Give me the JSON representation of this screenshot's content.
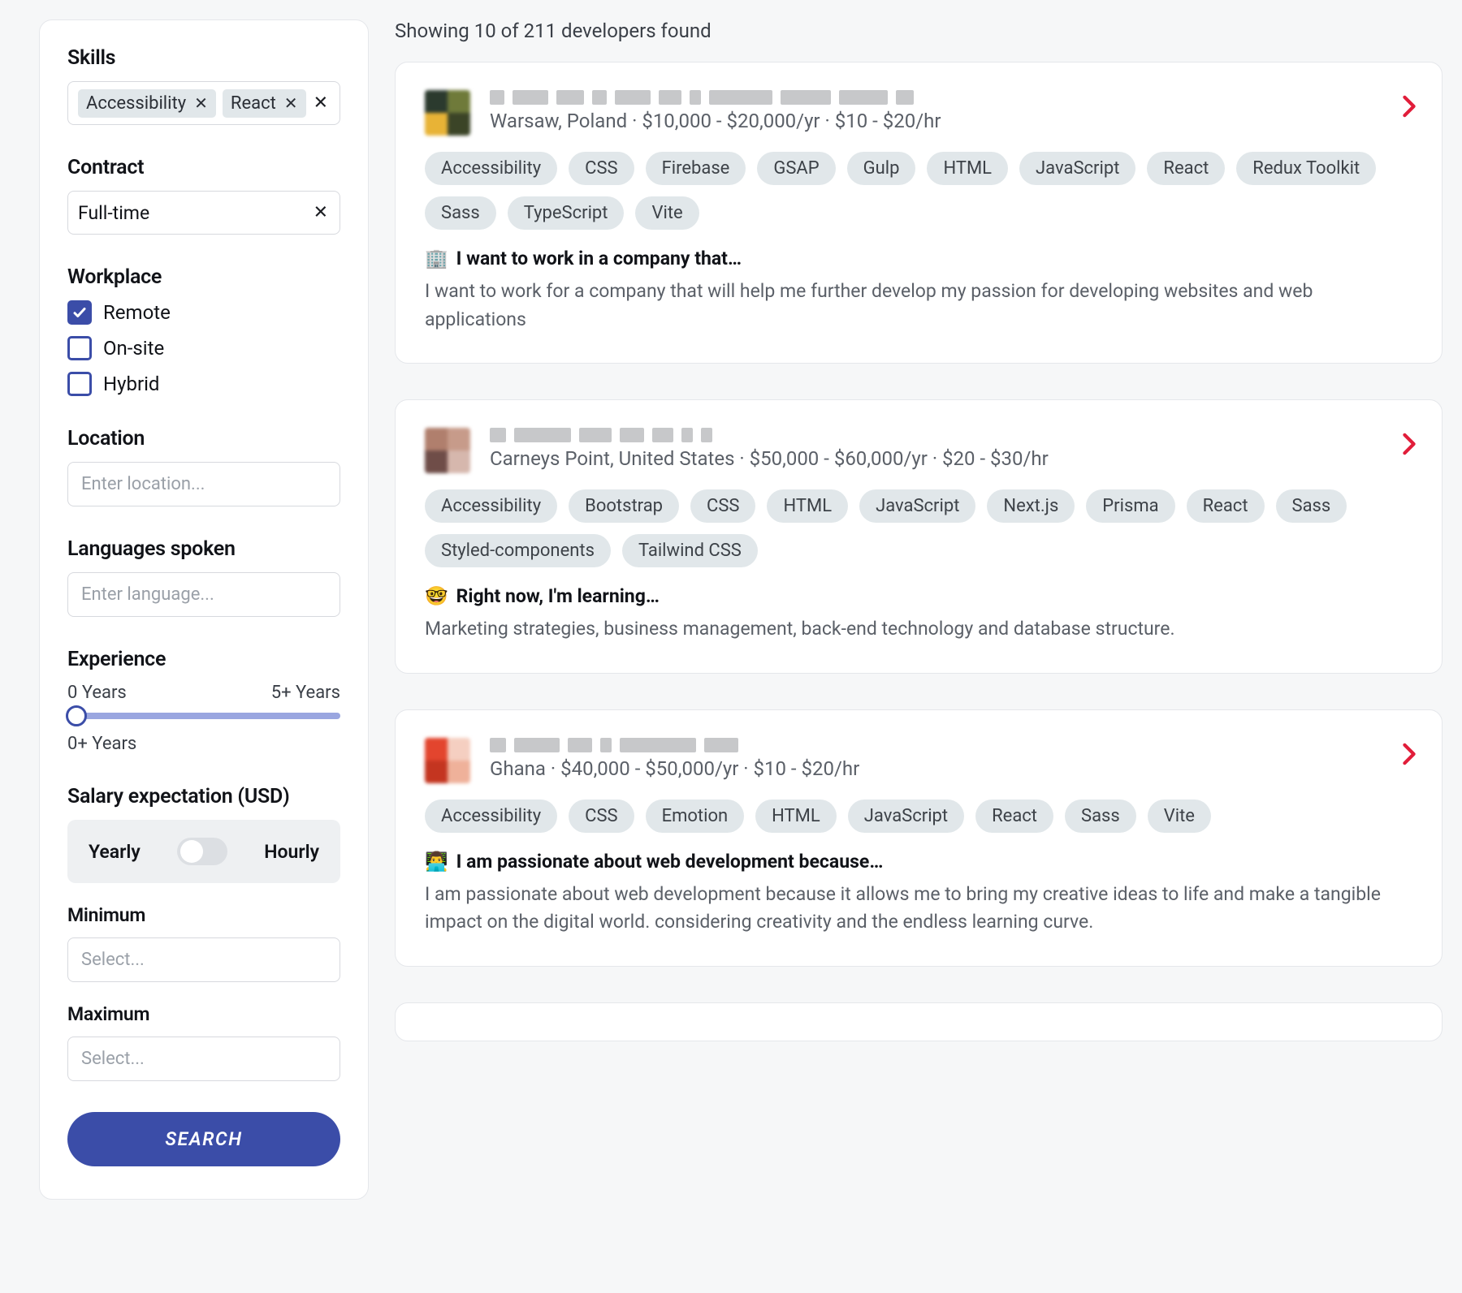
{
  "sidebar": {
    "skills": {
      "label": "Skills",
      "chips": [
        "Accessibility",
        "React"
      ]
    },
    "contract": {
      "label": "Contract",
      "value": "Full-time"
    },
    "workplace": {
      "label": "Workplace",
      "options": [
        {
          "label": "Remote",
          "checked": true
        },
        {
          "label": "On-site",
          "checked": false
        },
        {
          "label": "Hybrid",
          "checked": false
        }
      ]
    },
    "location": {
      "label": "Location",
      "placeholder": "Enter location..."
    },
    "languages": {
      "label": "Languages spoken",
      "placeholder": "Enter language..."
    },
    "experience": {
      "label": "Experience",
      "min_label": "0 Years",
      "max_label": "5+ Years",
      "value_label": "0+ Years"
    },
    "salary": {
      "label": "Salary expectation (USD)",
      "yearly": "Yearly",
      "hourly": "Hourly",
      "min_label": "Minimum",
      "max_label": "Maximum",
      "select_placeholder": "Select..."
    },
    "search_button": "SEARCH"
  },
  "results": {
    "header": "Showing 10 of 211 developers found",
    "cards": [
      {
        "meta": "Warsaw, Poland · $10,000 - $20,000/yr · $10 - $20/hr",
        "avatar_colors": [
          "#2b3a2e",
          "#6f7a3a",
          "#e8b336",
          "#3b4427"
        ],
        "name_blocks": [
          18,
          44,
          34,
          18,
          44,
          28,
          14,
          78,
          62,
          60,
          22
        ],
        "tags": [
          "Accessibility",
          "CSS",
          "Firebase",
          "GSAP",
          "Gulp",
          "HTML",
          "JavaScript",
          "React",
          "Redux Toolkit",
          "Sass",
          "TypeScript",
          "Vite"
        ],
        "highlight_emoji": "🏢",
        "highlight_title": "I want to work in a company that…",
        "highlight_body": "I want to work for a company that will help me further develop my passion for developing websites and web applications"
      },
      {
        "meta": "Carneys Point, United States · $50,000 - $60,000/yr · $20 - $30/hr",
        "avatar_colors": [
          "#b07f6d",
          "#c79b8a",
          "#6f4d48",
          "#d6b7ad"
        ],
        "name_blocks": [
          20,
          70,
          40,
          30,
          26,
          14,
          14
        ],
        "tags": [
          "Accessibility",
          "Bootstrap",
          "CSS",
          "HTML",
          "JavaScript",
          "Next.js",
          "Prisma",
          "React",
          "Sass",
          "Styled-components",
          "Tailwind CSS"
        ],
        "highlight_emoji": "🤓",
        "highlight_title": "Right now, I'm learning…",
        "highlight_body": "Marketing strategies, business management, back-end technology and database structure."
      },
      {
        "meta": "Ghana · $40,000 - $50,000/yr · $10 - $20/hr",
        "avatar_colors": [
          "#e3452e",
          "#f5cfc1",
          "#c43520",
          "#efb19a"
        ],
        "name_blocks": [
          20,
          56,
          30,
          14,
          94,
          42
        ],
        "tags": [
          "Accessibility",
          "CSS",
          "Emotion",
          "HTML",
          "JavaScript",
          "React",
          "Sass",
          "Vite"
        ],
        "highlight_emoji": "👨‍💻",
        "highlight_title": "I am passionate about web development because…",
        "highlight_body": "I am passionate about web development because it allows me to bring my creative ideas to life and make a tangible impact on the digital world. considering creativity and the endless learning curve."
      }
    ]
  }
}
